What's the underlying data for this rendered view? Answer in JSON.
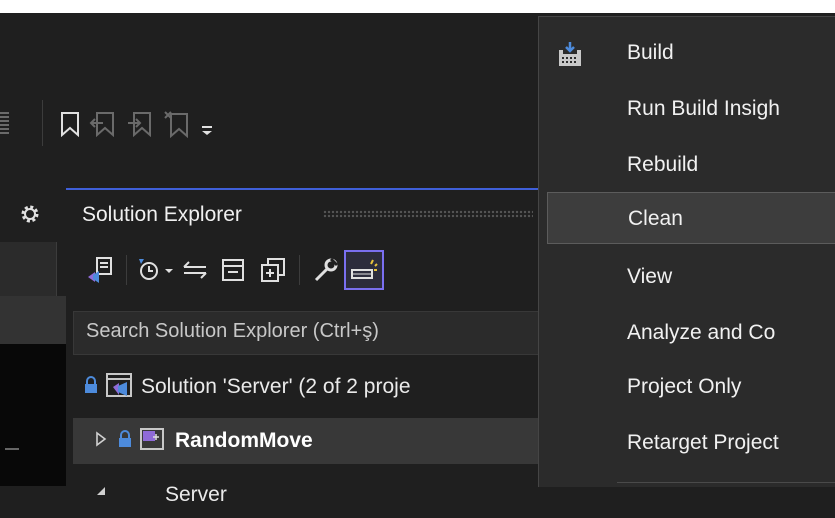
{
  "panel": {
    "title": "Solution Explorer",
    "search_placeholder": "Search Solution Explorer (Ctrl+ş)"
  },
  "tree": {
    "solution_label": "Solution 'Server' (2 of 2 proje",
    "project_randommove": "RandomMove",
    "project_server": "Server"
  },
  "menu": {
    "items": [
      {
        "label": "Build"
      },
      {
        "label": "Run Build Insigh"
      },
      {
        "label": "Rebuild"
      },
      {
        "label": "Clean"
      },
      {
        "label": "View"
      },
      {
        "label": "Analyze and Co"
      },
      {
        "label": "Project Only"
      },
      {
        "label": "Retarget Project"
      }
    ],
    "hovered": "Clean"
  },
  "icons": {
    "bookmark": "bookmark-icon",
    "prev_bookmark": "previous-bookmark-icon",
    "next_bookmark": "next-bookmark-icon",
    "clear_bookmarks": "clear-bookmarks-icon",
    "toolbar_overflow": "overflow-dropdown-icon",
    "settings": "gear-icon",
    "vs_switch": "switch-views-icon",
    "history": "pending-changes-icon",
    "sync": "sync-with-active-document-icon",
    "collapse_all": "collapse-all-icon",
    "show_all_files": "show-all-files-icon",
    "properties": "wrench-icon",
    "build_clean": "clean-build-icon",
    "lock": "lock-icon",
    "build_menu_icon": "build-icon"
  },
  "colors": {
    "accent": "#3f5fd8",
    "menu_bg": "#2b2b2b",
    "selected_row": "#383838"
  }
}
